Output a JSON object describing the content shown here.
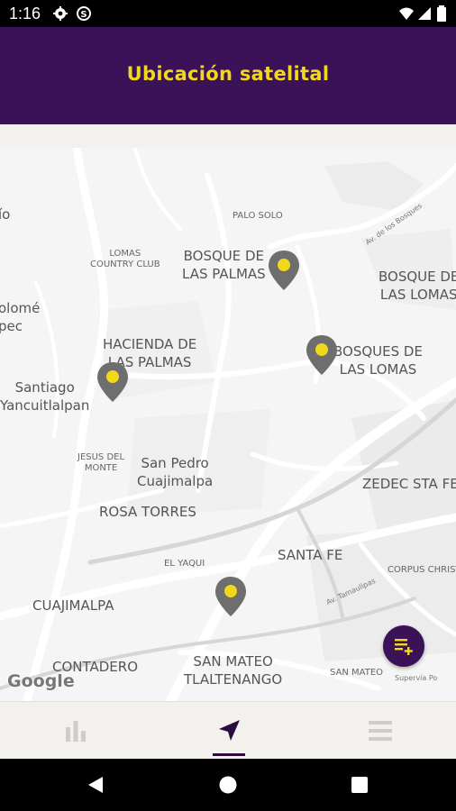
{
  "status_bar": {
    "time": "1:16"
  },
  "app_bar": {
    "title": "Ubicación satelital"
  },
  "map": {
    "labels": [
      {
        "text": "ío"
      },
      {
        "text": "PALO SOLO"
      },
      {
        "text": "LOMAS\nCOUNTRY CLUB"
      },
      {
        "text": "BOSQUE DE\nLAS PALMAS"
      },
      {
        "text": "BOSQUE DE\nLAS LOMAS"
      },
      {
        "text": "olomé\npec"
      },
      {
        "text": "HACIENDA DE\nLAS PALMAS"
      },
      {
        "text": "BOSQUES DE\nLAS LOMAS"
      },
      {
        "text": "Santiago\nYancuitlalpan"
      },
      {
        "text": "JESUS DEL\nMONTE"
      },
      {
        "text": "San Pedro\nCuajimalpa"
      },
      {
        "text": "ZEDEC STA FE"
      },
      {
        "text": "ROSA TORRES"
      },
      {
        "text": "SANTA FE"
      },
      {
        "text": "EL YAQUI"
      },
      {
        "text": "CORPUS CHRISTI"
      },
      {
        "text": "CUAJIMALPA"
      },
      {
        "text": "CONTADERO"
      },
      {
        "text": "SAN MATEO\nTLALTENANGO"
      },
      {
        "text": "SAN MATEO"
      },
      {
        "text": "Av. de los Bosques"
      },
      {
        "text": "Av. Tamaulipas"
      },
      {
        "text": "Supervía Po"
      }
    ],
    "google_logo": "Google"
  },
  "colors": {
    "primary": "#3b1158",
    "accent": "#f2d81a",
    "pin": "#6e6e6e"
  },
  "fab": {
    "icon": "list-add-icon"
  },
  "bottom_nav": [
    {
      "icon": "bar-chart-icon",
      "active": false
    },
    {
      "icon": "navigation-arrow-icon",
      "active": true
    },
    {
      "icon": "menu-lines-icon",
      "active": false
    }
  ]
}
